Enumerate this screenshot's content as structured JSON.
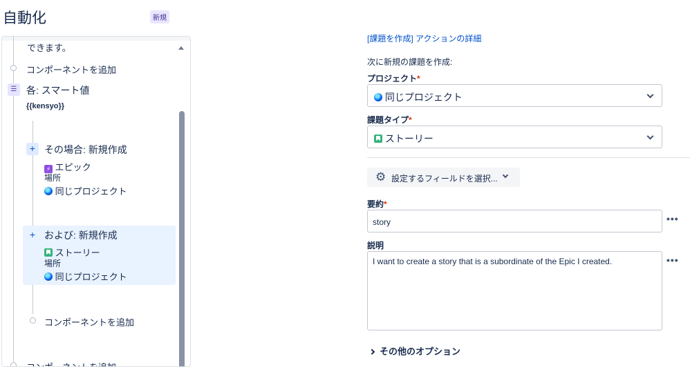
{
  "header": {
    "title": "自動化",
    "badge": "新規"
  },
  "rule": {
    "top_text": "できます。",
    "add_component_1": "コンポーネントを追加",
    "branch_title": "各: スマート値",
    "branch_value": "{{kensyo}}",
    "action1": {
      "title": "その場合: 新規作成",
      "issue_type": "エピック",
      "place_label": "場所",
      "project": "同じプロジェクト"
    },
    "action2": {
      "title": "および: 新規作成",
      "issue_type": "ストーリー",
      "place_label": "場所",
      "project": "同じプロジェクト"
    },
    "add_component_2": "コンポーネントを追加",
    "add_component_3": "コンポーネントを追加"
  },
  "config": {
    "top_link": "[課題を作成] アクションの詳細",
    "intro": "次に新規の課題を作成:",
    "project_label": "プロジェクト",
    "project_value": "同じプロジェクト",
    "issue_type_label": "課題タイプ",
    "issue_type_value": "ストーリー",
    "required_mark": "*",
    "fields_button": "設定するフィールドを選択...",
    "summary_label": "要約",
    "summary_value": "story",
    "description_label": "説明",
    "description_value": "I want to create a story that is a subordinate of the Epic I created.",
    "more_dots": "•••",
    "more_options": "その他のオプション"
  }
}
